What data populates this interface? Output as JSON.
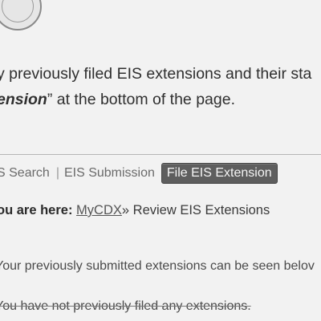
{
  "intro": {
    "line1": "y previously filed EIS extensions and their sta",
    "line2_emph": "ension",
    "line2_rest": "” at the bottom of the page."
  },
  "tabs": {
    "search": "S Search",
    "submission": "EIS Submission",
    "file_extension": "File EIS Extension"
  },
  "breadcrumb": {
    "label": "ou are here:",
    "link": "MyCDX",
    "current": "» Review EIS Extensions"
  },
  "messages": {
    "submitted_info": "Your previously submitted extensions can be seen belov",
    "none_filed": "You have not previously filed any extensions."
  }
}
